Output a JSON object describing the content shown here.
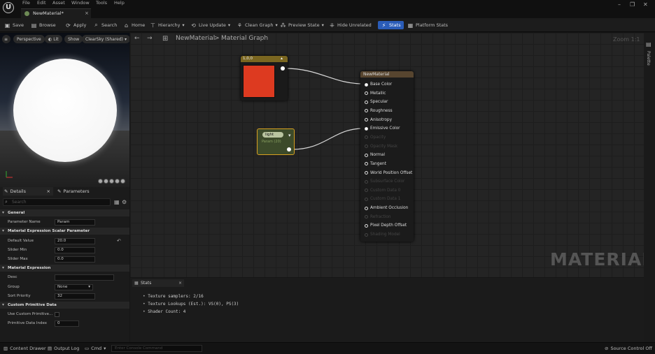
{
  "menu": [
    "File",
    "Edit",
    "Asset",
    "Window",
    "Tools",
    "Help"
  ],
  "document_tab": {
    "label": "NewMaterial*",
    "close": "×"
  },
  "window_controls": {
    "minimize": "–",
    "restore": "❐",
    "close": "✕"
  },
  "toolbar": {
    "save": "Save",
    "browse": "Browse",
    "apply": "Apply",
    "search": "Search",
    "home": "Home",
    "hierarchy": "Hierarchy",
    "live_update": "Live Update",
    "clean_graph": "Clean Graph",
    "preview_state": "Preview State",
    "hide_unrelated": "Hide Unrelated",
    "stats": "Stats",
    "platform_stats": "Platform Stats"
  },
  "viewport": {
    "perspective": "Perspective",
    "lit": "Lit",
    "show": "Show",
    "sky": "ClearSky (Shared)"
  },
  "details": {
    "tab_details": "Details",
    "tab_parameters": "Parameters",
    "search_placeholder": "Search",
    "sections": {
      "general": "General",
      "scalar": "Material Expression Scalar Parameter",
      "expression": "Material Expression",
      "primitive": "Custom Primitive Data"
    },
    "fields": {
      "param_name_k": "Parameter Name",
      "param_name_v": "Param",
      "default_k": "Default Value",
      "default_v": "20.0",
      "slider_min_k": "Slider Min",
      "slider_min_v": "0.0",
      "slider_max_k": "Slider Max",
      "slider_max_v": "0.0",
      "desc_k": "Desc",
      "desc_v": "",
      "group_k": "Group",
      "group_v": "None",
      "sort_k": "Sort Priority",
      "sort_v": "32",
      "use_custom_k": "Use Custom Primitive...",
      "prim_index_k": "Primitive Data Index",
      "prim_index_v": "0"
    }
  },
  "graph": {
    "breadcrumb_material": "NewMaterial",
    "breadcrumb_sep": ">",
    "breadcrumb_graph": "Material Graph",
    "zoom": "Zoom 1:1",
    "watermark": "MATERIAL",
    "color_node": {
      "title": "1,0,0",
      "color": "#dd3a20"
    },
    "param_node": {
      "name": "light",
      "sub": "Param (20)"
    },
    "material_node": {
      "title": "NewMaterial",
      "inputs": [
        {
          "label": "Base Color",
          "active": true,
          "connected": true
        },
        {
          "label": "Metallic",
          "active": true
        },
        {
          "label": "Specular",
          "active": true
        },
        {
          "label": "Roughness",
          "active": true
        },
        {
          "label": "Anisotropy",
          "active": true
        },
        {
          "label": "Emissive Color",
          "active": true,
          "connected": true
        },
        {
          "label": "Opacity",
          "active": false
        },
        {
          "label": "Opacity Mask",
          "active": false
        },
        {
          "label": "Normal",
          "active": true
        },
        {
          "label": "Tangent",
          "active": true
        },
        {
          "label": "World Position Offset",
          "active": true
        },
        {
          "label": "Subsurface Color",
          "active": false
        },
        {
          "label": "Custom Data 0",
          "active": false
        },
        {
          "label": "Custom Data 1",
          "active": false
        },
        {
          "label": "Ambient Occlusion",
          "active": true
        },
        {
          "label": "Refraction",
          "active": false
        },
        {
          "label": "Pixel Depth Offset",
          "active": true
        },
        {
          "label": "Shading Model",
          "active": false
        }
      ]
    }
  },
  "stats": {
    "tab": "Stats",
    "lines": [
      "Texture samplers: 2/16",
      "Texture Lookups (Est.): VS(0), PS(3)",
      "Shader Count: 4"
    ]
  },
  "statusbar": {
    "content_drawer": "Content Drawer",
    "output_log": "Output Log",
    "cmd": "Cmd",
    "console_placeholder": "Enter Console Command",
    "source_control": "Source Control Off"
  },
  "right_strip": "Palette"
}
